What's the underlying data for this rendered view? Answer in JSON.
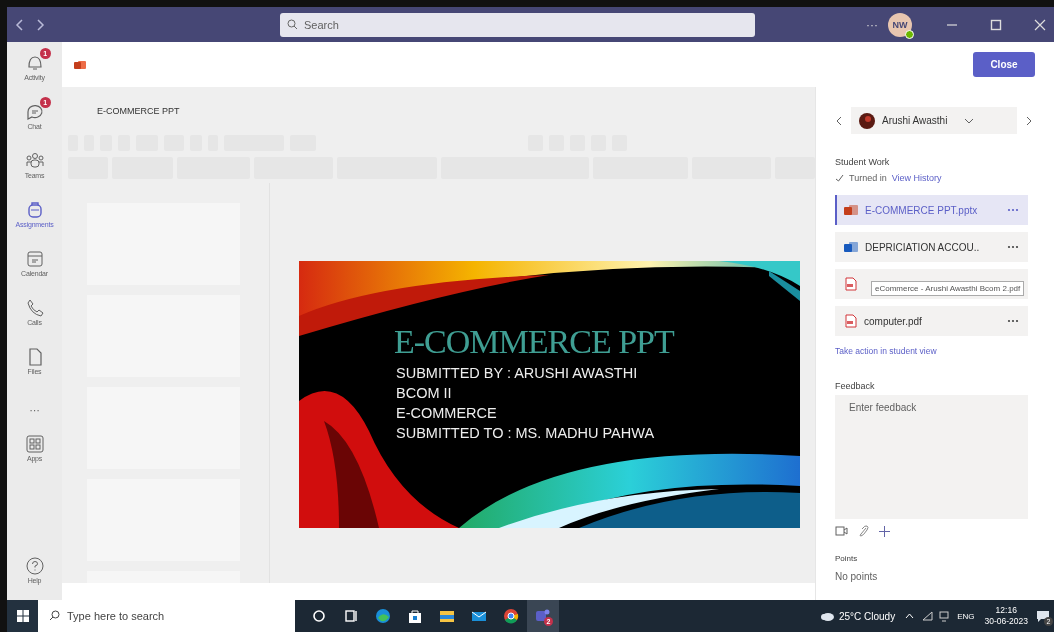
{
  "titlebar": {
    "search": {
      "placeholder": "Search"
    },
    "more": "···",
    "avatar": {
      "initials": "NW"
    }
  },
  "rail": {
    "items": [
      {
        "kind": "bell",
        "label": "Activity",
        "badge": "1",
        "selected": false
      },
      {
        "kind": "chat",
        "label": "Chat",
        "badge": "1",
        "selected": false
      },
      {
        "kind": "teams",
        "label": "Teams",
        "selected": false
      },
      {
        "kind": "bag",
        "label": "Assignments",
        "selected": true
      },
      {
        "kind": "calendar",
        "label": "Calendar",
        "selected": false
      },
      {
        "kind": "phone",
        "label": "Calls",
        "selected": false
      },
      {
        "kind": "file",
        "label": "Files",
        "selected": false
      },
      {
        "kind": "more",
        "label": "···",
        "selected": false
      },
      {
        "kind": "apps",
        "label": "Apps",
        "selected": false
      }
    ],
    "help": {
      "label": "Help"
    }
  },
  "viewer": {
    "file_title": "E-COMMERCE PPT",
    "close": "Close",
    "slide": {
      "title": "E-COMMERCE PPT",
      "lines": [
        "SUBMITTED BY : ARUSHI AWASTHI",
        "BCOM II",
        "E-COMMERCE",
        "SUBMITTED TO : MS. MADHU PAHWA"
      ]
    }
  },
  "panel": {
    "student": "Arushi Awasthi",
    "section": "Student Work",
    "status": "Turned in",
    "history_link": "View History",
    "files": [
      {
        "kind": "pptx",
        "name": "E-COMMERCE PPT.pptx",
        "selected": true
      },
      {
        "kind": "docx",
        "name": "DEPRICIATION ACCOU..",
        "selected": false
      },
      {
        "kind": "pdf",
        "tooltip": "eCommerce - Arushi Awasthi Bcom 2.pdf",
        "selected": false
      },
      {
        "kind": "pdf",
        "name": "computer.pdf",
        "selected": false
      }
    ],
    "action_link": "Take action in student view",
    "feedback_label": "Feedback",
    "feedback": {
      "placeholder": "Enter feedback"
    },
    "points_label": "Points",
    "points": "No points"
  },
  "taskbar": {
    "search": {
      "placeholder": "Type here to search"
    },
    "apps": [
      {
        "kind": "cortana",
        "selected": false
      },
      {
        "kind": "taskview",
        "selected": false
      },
      {
        "kind": "edge",
        "selected": false
      },
      {
        "kind": "store",
        "selected": false
      },
      {
        "kind": "explorer",
        "selected": false
      },
      {
        "kind": "mail",
        "selected": false
      },
      {
        "kind": "chrome",
        "selected": false
      },
      {
        "kind": "teams",
        "badge": "2",
        "selected": true
      }
    ],
    "weather": "25°C Cloudy",
    "language": "ENG",
    "time": "12:16",
    "date": "30-06-2023",
    "notifications": "2"
  }
}
